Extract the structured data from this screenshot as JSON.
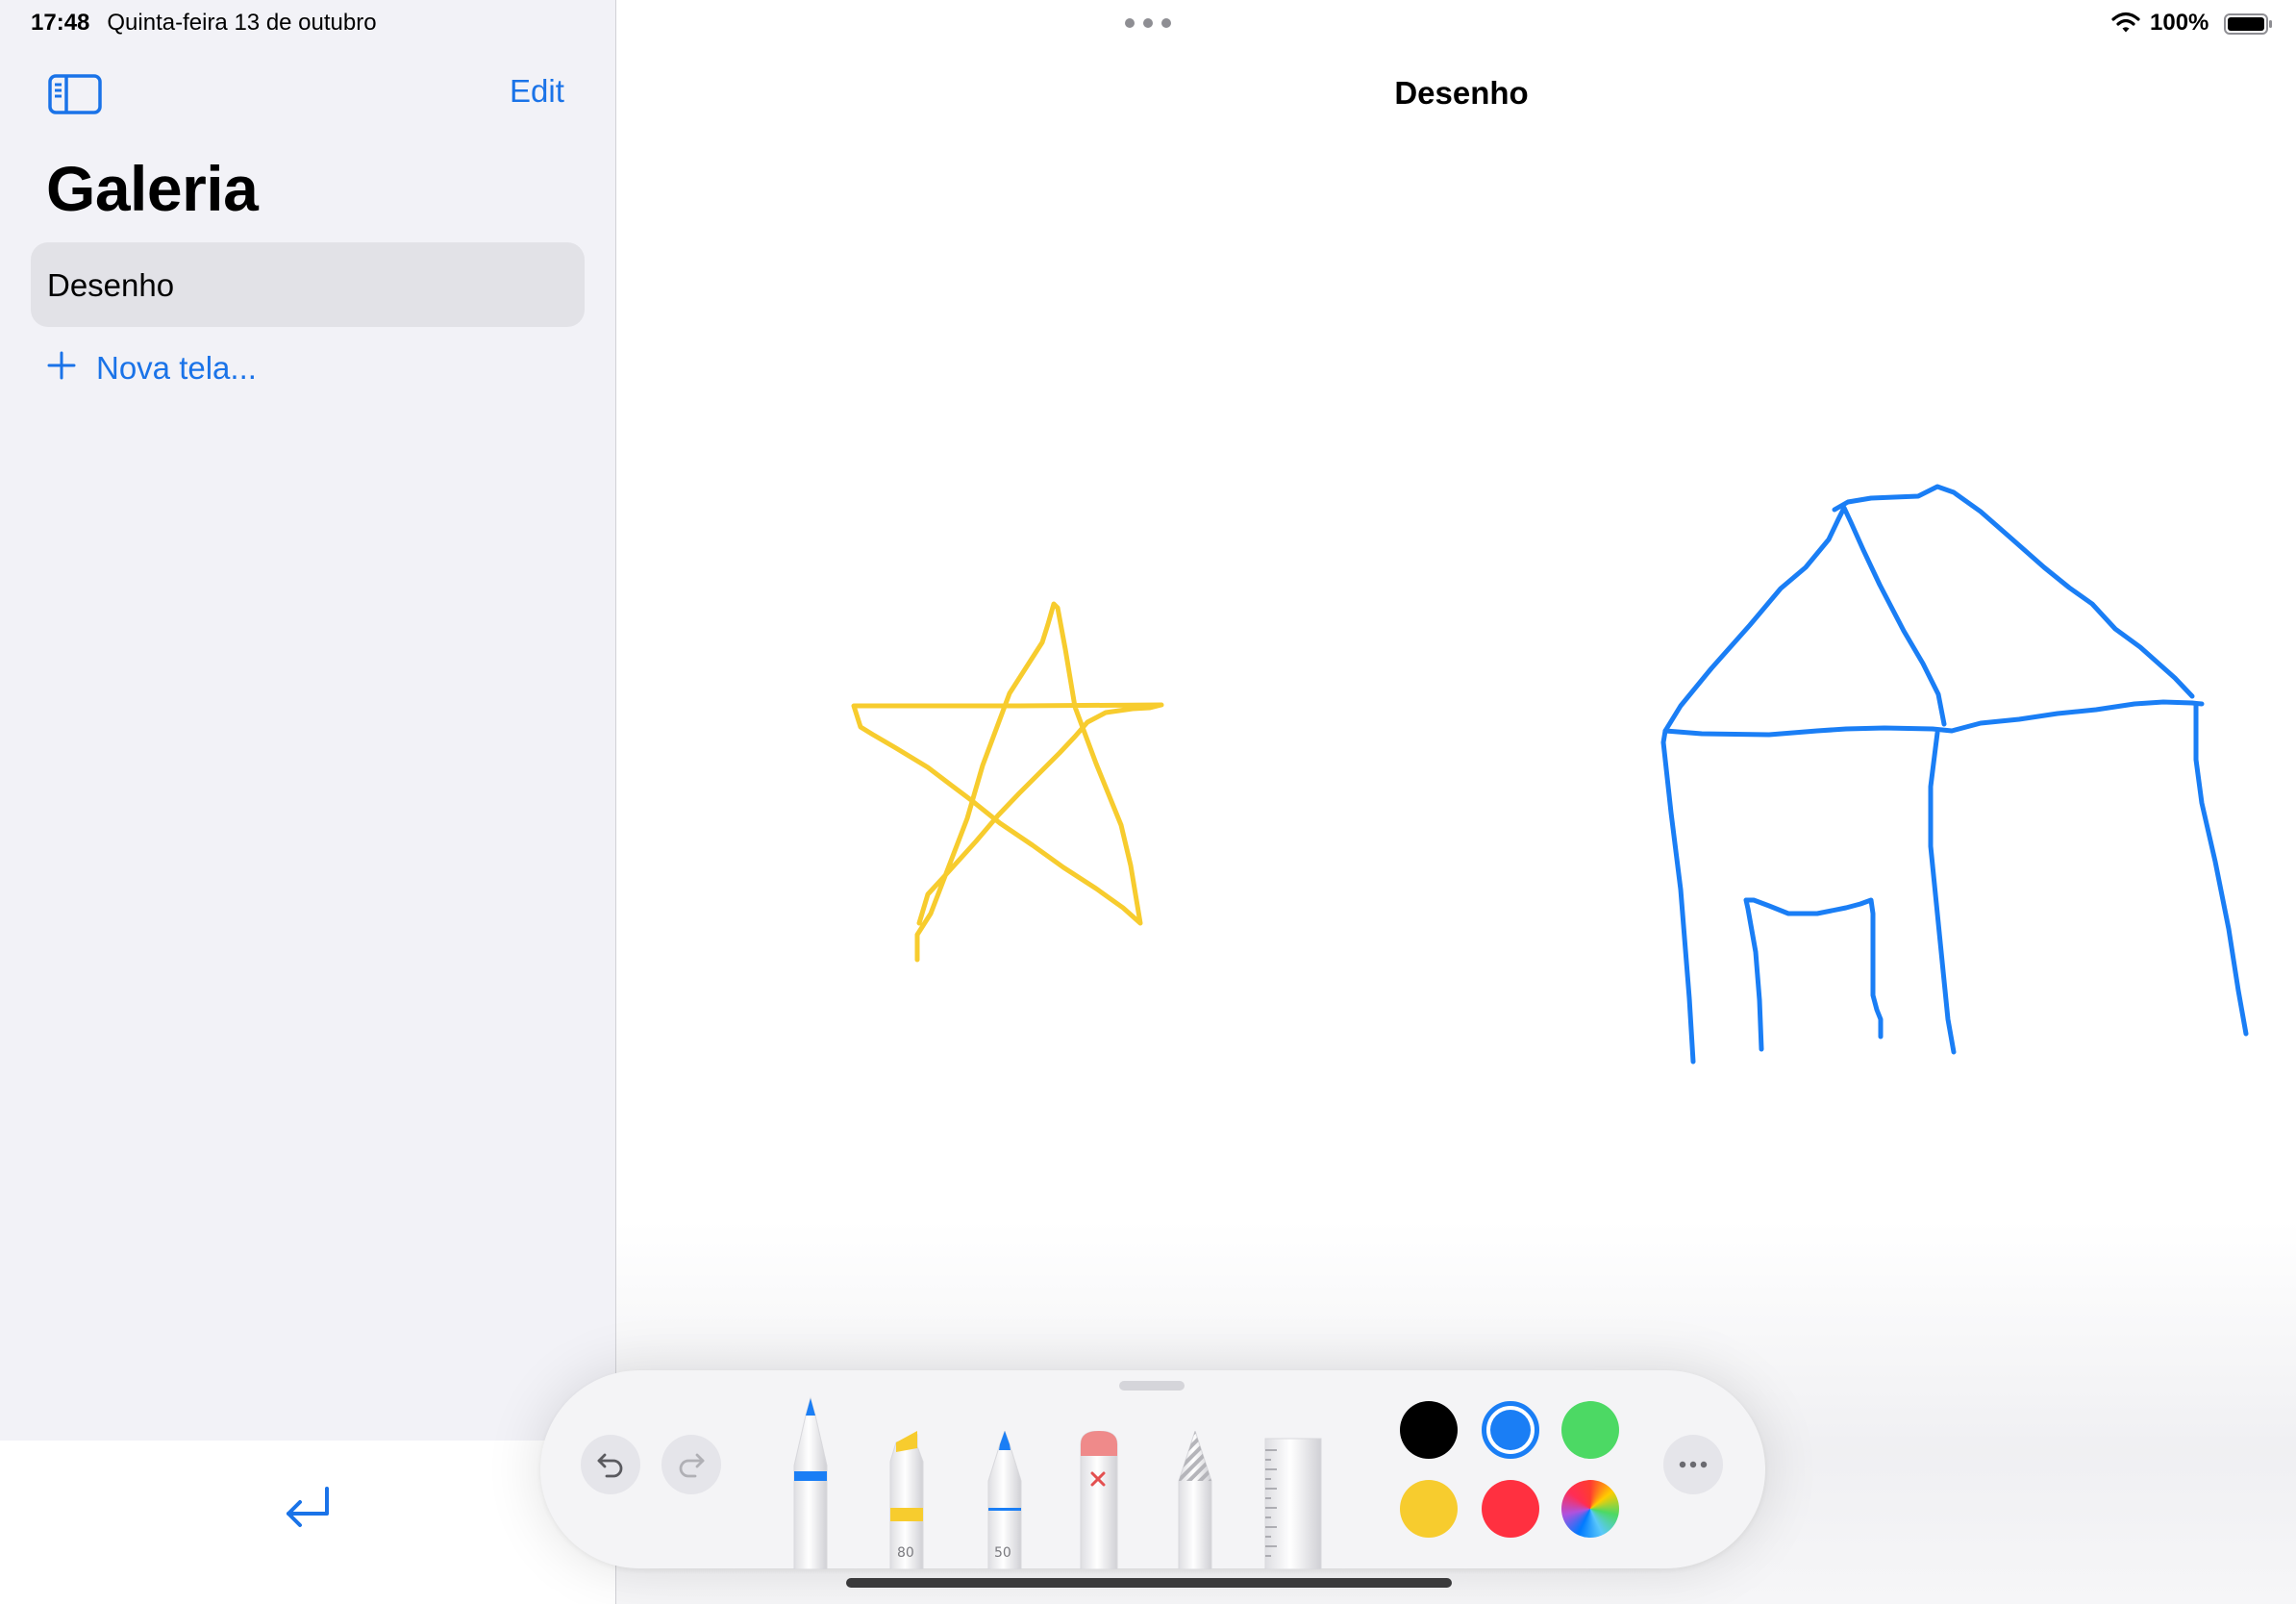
{
  "status_bar": {
    "time": "17:48",
    "date": "Quinta-feira 13 de outubro",
    "battery": "100%"
  },
  "sidebar": {
    "toggle_icon": "sidebar-toggle-icon",
    "edit_label": "Edit",
    "title": "Galeria",
    "items": [
      {
        "label": "Desenho",
        "selected": true
      }
    ],
    "new_canvas_label": "Nova tela...",
    "return_icon": "return-arrow-icon"
  },
  "document": {
    "title": "Desenho",
    "strokes": [
      {
        "name": "star",
        "color": "#f7cc2e"
      },
      {
        "name": "house",
        "color": "#1a7ef5"
      }
    ]
  },
  "tool_palette": {
    "undo_icon": "undo-icon",
    "redo_icon": "redo-icon",
    "tools": [
      {
        "name": "pen",
        "accent": "#1a7ef5",
        "number": ""
      },
      {
        "name": "marker",
        "accent": "#f7cc2e",
        "number": "80"
      },
      {
        "name": "pencil",
        "accent": "#1a7ef5",
        "number": "50"
      },
      {
        "name": "eraser",
        "accent": "#e36b6b",
        "number": ""
      },
      {
        "name": "lasso",
        "accent": "#b0b0b5",
        "number": ""
      },
      {
        "name": "ruler",
        "accent": "#d0d0d5",
        "number": ""
      }
    ],
    "colors": [
      {
        "name": "black",
        "hex": "#000000",
        "selected": false
      },
      {
        "name": "blue",
        "hex": "#1a7ef5",
        "selected": true
      },
      {
        "name": "green",
        "hex": "#4cd964",
        "selected": false
      },
      {
        "name": "yellow",
        "hex": "#f7cc2e",
        "selected": false
      },
      {
        "name": "red",
        "hex": "#ff3040",
        "selected": false
      },
      {
        "name": "multicolor",
        "hex": "conic",
        "selected": false
      }
    ],
    "more_icon": "ellipsis-icon"
  }
}
